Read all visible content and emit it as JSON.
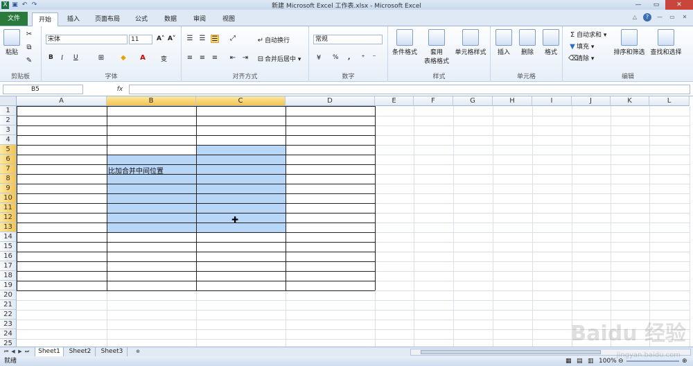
{
  "window": {
    "title": "新建 Microsoft Excel 工作表.xlsx - Microsoft Excel"
  },
  "qat_icons": [
    "excel-logo-icon",
    "save-icon",
    "undo-icon",
    "redo-icon"
  ],
  "tabs": [
    {
      "label": "文件"
    },
    {
      "label": "开始"
    },
    {
      "label": "插入"
    },
    {
      "label": "页面布局"
    },
    {
      "label": "公式"
    },
    {
      "label": "数据"
    },
    {
      "label": "审阅"
    },
    {
      "label": "视图"
    }
  ],
  "ribbon": {
    "clipboard": {
      "label": "剪贴板",
      "paste": "粘贴"
    },
    "font": {
      "label": "字体",
      "name": "宋体",
      "size": "11",
      "bold": "B",
      "italic": "I",
      "underline": "U",
      "grow": "A˄",
      "shrink": "A˅",
      "wen": "变"
    },
    "align": {
      "label": "对齐方式",
      "wrap": "自动换行",
      "merge": "合并后居中"
    },
    "number": {
      "label": "数字",
      "format": "常规",
      "percent": "%",
      "comma": ","
    },
    "styles": {
      "label": "样式",
      "cond": "条件格式",
      "table1": "套用",
      "table2": "表格格式",
      "cell": "单元格样式"
    },
    "cells": {
      "label": "单元格",
      "insert": "插入",
      "delete": "删除",
      "format": "格式"
    },
    "editing": {
      "label": "编辑",
      "autosum": "自动求和",
      "fill": "填充",
      "clear": "清除",
      "sort": "排序和筛选",
      "find": "查找和选择"
    }
  },
  "formula_bar": {
    "name_box": "B5",
    "fx": "fx",
    "value": ""
  },
  "columns": [
    "A",
    "B",
    "C",
    "D",
    "E",
    "F",
    "G",
    "H",
    "I",
    "J",
    "K",
    "L"
  ],
  "rows": [
    "1",
    "2",
    "3",
    "4",
    "5",
    "6",
    "7",
    "8",
    "9",
    "10",
    "11",
    "12",
    "13",
    "14",
    "15",
    "16",
    "17",
    "18",
    "19",
    "20",
    "21",
    "22",
    "23",
    "24",
    "25"
  ],
  "cell_text": "比加合并中间位置",
  "sheets": [
    "Sheet1",
    "Sheet2",
    "Sheet3"
  ],
  "status": {
    "ready": "就绪",
    "zoom": "100%"
  },
  "watermark": {
    "main": "Baidu 经验",
    "sub": "jingyan.baidu.com"
  }
}
